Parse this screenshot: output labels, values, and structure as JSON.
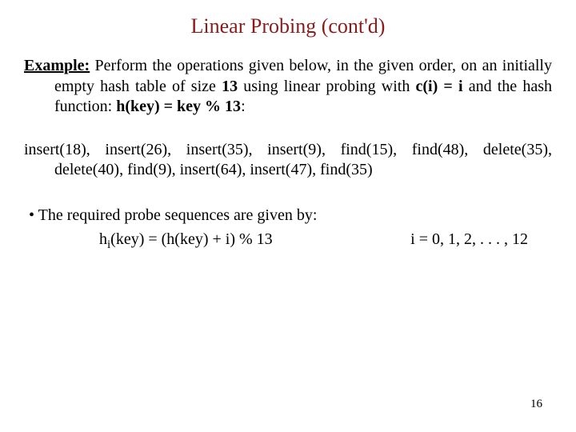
{
  "title": "Linear Probing (cont'd)",
  "example_label": "Example:",
  "example_text_1": " Perform the operations given below, in the given order, on an initially empty hash table of size ",
  "table_size": "13",
  "example_text_2": " using linear probing with ",
  "probe_fn": "c(i) = i",
  "example_text_3": " and the hash function: ",
  "hash_fn": "h(key) = key % 13",
  "colon": ":",
  "operations": "insert(18),  insert(26),  insert(35),  insert(9),  find(15),  find(48), delete(35), delete(40), find(9), insert(64), insert(47), find(35)",
  "bullet_text": "The required probe sequences are given by:",
  "formula_lhs_1": "h",
  "formula_sub": "i",
  "formula_lhs_2": "(key) = (h(key) + i) % 13",
  "formula_rhs": "i = 0, 1, 2, . . . , 12",
  "page_number": "16",
  "bullet_mark": "•"
}
